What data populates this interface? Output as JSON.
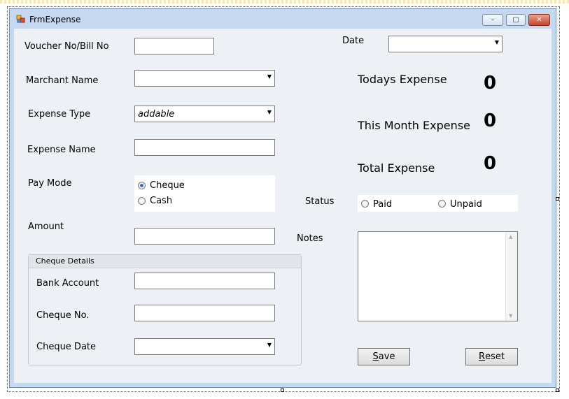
{
  "window": {
    "title": "FrmExpense",
    "minimize_glyph": "–",
    "maximize_glyph": "▢",
    "close_glyph": "✕"
  },
  "form": {
    "voucher_label": "Voucher No/Bill No",
    "voucher_value": "",
    "merchant_label": "Marchant Name",
    "merchant_value": "",
    "expense_type_label": "Expense Type",
    "expense_type_value": "addable",
    "expense_name_label": "Expense Name",
    "expense_name_value": "",
    "pay_mode_label": "Pay Mode",
    "pay_mode_options": [
      "Cheque",
      "Cash"
    ],
    "pay_mode_selected": "Cheque",
    "amount_label": "Amount",
    "amount_value": "",
    "cheque_group_title": "Cheque Details",
    "bank_account_label": "Bank Account",
    "bank_account_value": "",
    "cheque_no_label": "Cheque No.",
    "cheque_no_value": "",
    "cheque_date_label": "Cheque Date",
    "cheque_date_value": "",
    "date_label": "Date",
    "date_value": "",
    "status_label": "Status",
    "status_options": [
      "Paid",
      "Unpaid"
    ],
    "status_selected": "",
    "notes_label": "Notes",
    "notes_value": ""
  },
  "summary": {
    "today_label": "Todays Expense",
    "today_value": "0",
    "month_label": "This Month Expense",
    "month_value": "0",
    "total_label": "Total Expense",
    "total_value": "0"
  },
  "buttons": {
    "save_mnemonic": "S",
    "save_rest": "ave",
    "reset_mnemonic": "R",
    "reset_rest": "eset"
  },
  "icons": {
    "app_icon": "app-form-icon",
    "dropdown": "chevron-down-icon"
  },
  "colors": {
    "frame": "#c5d8ef",
    "client": "#edf0f5",
    "radio_selected": "#3e6fc4"
  }
}
